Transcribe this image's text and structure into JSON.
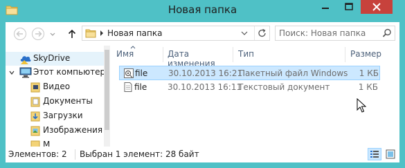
{
  "window": {
    "title": "Новая папка",
    "accent_color": "#4fc1c6",
    "close_color": "#c7423c"
  },
  "nav": {
    "back_icon": "arrow-left-icon",
    "forward_icon": "arrow-right-icon",
    "history_icon": "chevron-down-icon",
    "up_icon": "arrow-up-icon"
  },
  "address": {
    "path": "Новая папка",
    "refresh_icon": "refresh-icon"
  },
  "search": {
    "placeholder": "Поиск: Новая папка"
  },
  "navpane": {
    "items": [
      {
        "label": "SkyDrive",
        "icon": "skydrive-icon"
      },
      {
        "label": "Этот компьютер",
        "icon": "computer-icon"
      },
      {
        "label": "Видео",
        "icon": "video-folder-icon"
      },
      {
        "label": "Документы",
        "icon": "documents-folder-icon"
      },
      {
        "label": "Загрузки",
        "icon": "downloads-folder-icon"
      },
      {
        "label": "Изображения",
        "icon": "pictures-folder-icon"
      },
      {
        "label": "М",
        "icon": "music-folder-icon"
      }
    ]
  },
  "columns": {
    "name": "Имя",
    "date": "Дата изменения",
    "type": "Тип",
    "size": "Размер"
  },
  "files": [
    {
      "name": "file",
      "date": "30.10.2013 16:21",
      "type": "Пакетный файл Windows",
      "size": "1 КБ",
      "icon": "batch-file-icon",
      "selected": true
    },
    {
      "name": "file",
      "date": "30.10.2013 16:11",
      "type": "Текстовый документ",
      "size": "1 КБ",
      "icon": "text-file-icon",
      "selected": false
    }
  ],
  "status": {
    "count": "Элементов: 2",
    "selection": "Выбран 1 элемент: 28 байт"
  }
}
